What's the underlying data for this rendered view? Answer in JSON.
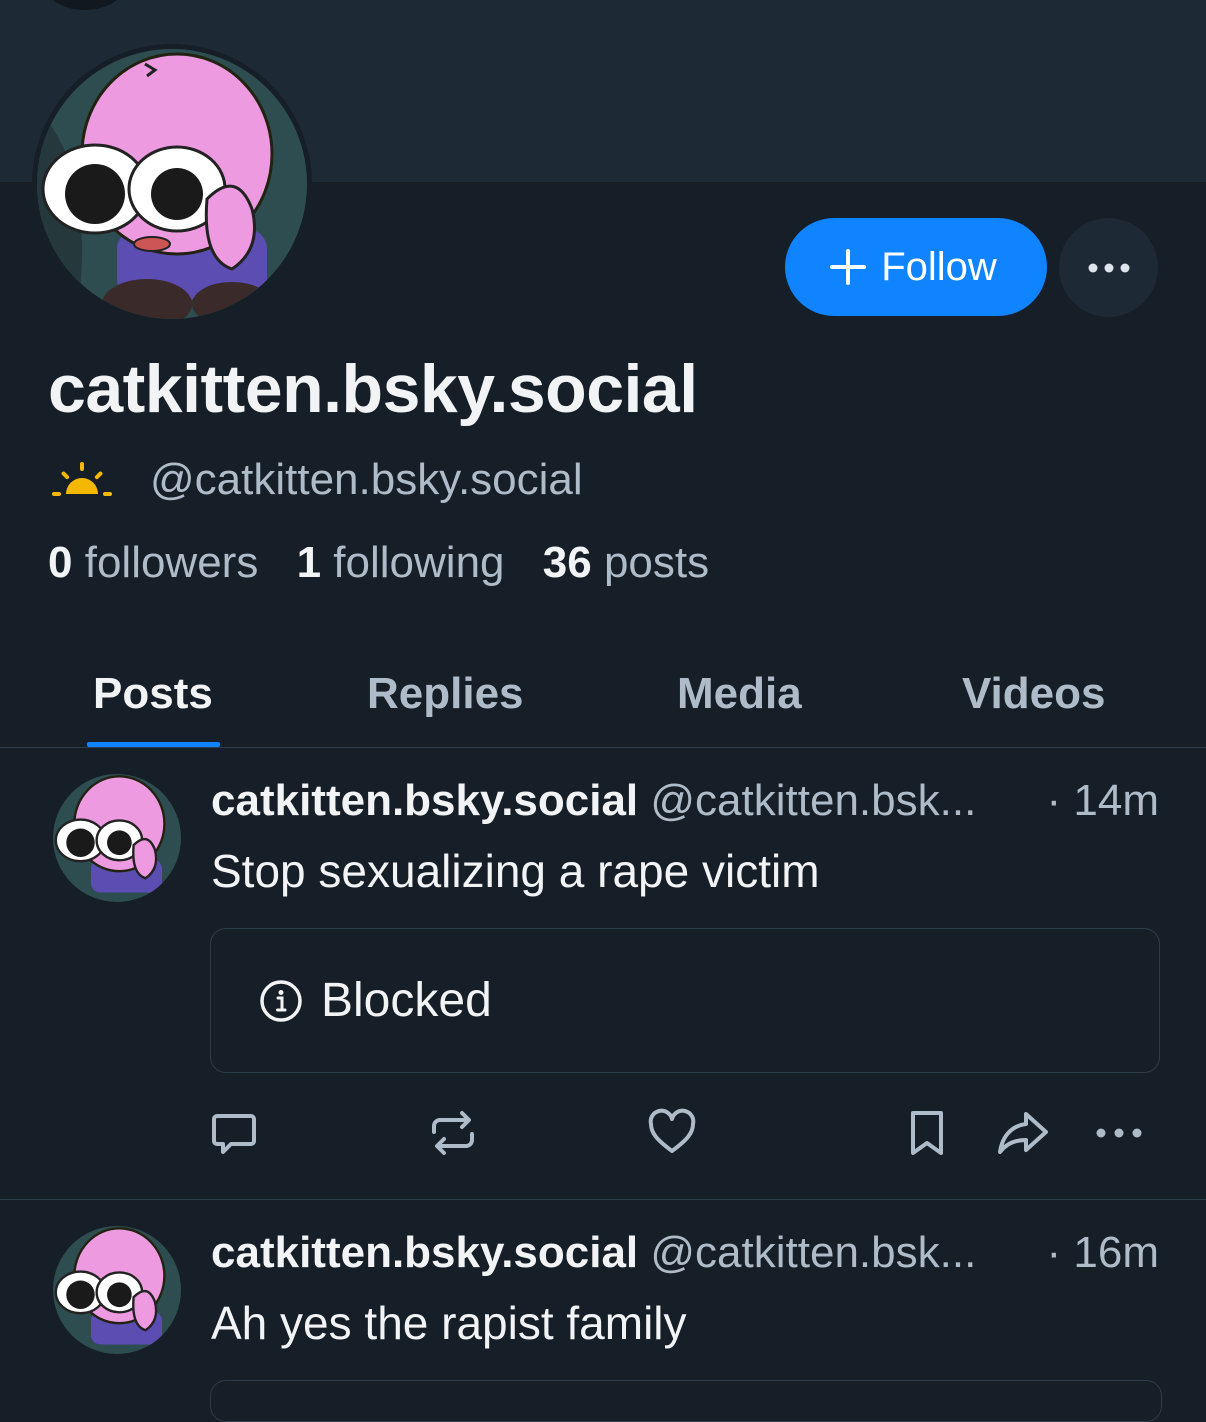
{
  "profile": {
    "display_name": "catkitten.bsky.social",
    "handle": "@catkitten.bsky.social",
    "badge_icon": "sunrise-icon",
    "badge_color": "#f5b800",
    "follow_label": "Follow",
    "stats": {
      "followers_count": "0",
      "followers_label": "followers",
      "following_count": "1",
      "following_label": "following",
      "posts_count": "36",
      "posts_label": "posts"
    }
  },
  "tabs": [
    {
      "label": "Posts",
      "active": true
    },
    {
      "label": "Replies",
      "active": false
    },
    {
      "label": "Media",
      "active": false
    },
    {
      "label": "Videos",
      "active": false
    }
  ],
  "posts": [
    {
      "author": "catkitten.bsky.social",
      "handle": "@catkitten.bsk...",
      "time": "· 14m",
      "text": "Stop sexualizing a rape victim",
      "embed_label": "Blocked"
    },
    {
      "author": "catkitten.bsky.social",
      "handle": "@catkitten.bsk...",
      "time": "· 16m",
      "text": "Ah yes the rapist family"
    }
  ],
  "colors": {
    "accent": "#1083fe",
    "background": "#161e27",
    "banner": "#1e2936",
    "muted_text": "#aebbc9"
  }
}
